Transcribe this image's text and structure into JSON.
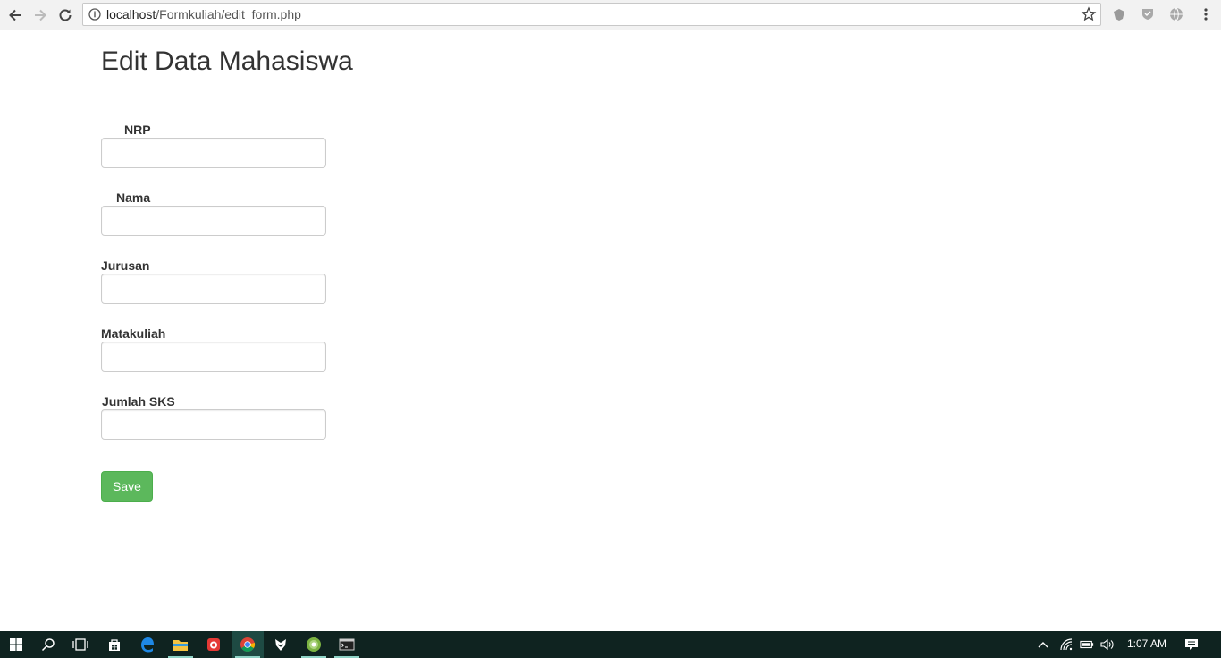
{
  "browser": {
    "url_host": "localhost",
    "url_path": "/Formkuliah/edit_form.php"
  },
  "page": {
    "title": "Edit Data Mahasiswa",
    "fields": [
      {
        "label": "NRP",
        "value": ""
      },
      {
        "label": "Nama",
        "value": ""
      },
      {
        "label": "Jurusan",
        "value": ""
      },
      {
        "label": "Matakuliah",
        "value": ""
      },
      {
        "label": "Jumlah SKS",
        "value": ""
      }
    ],
    "save_label": "Save"
  },
  "taskbar": {
    "clock": "1:07 AM",
    "accent": "#5cb85c"
  }
}
